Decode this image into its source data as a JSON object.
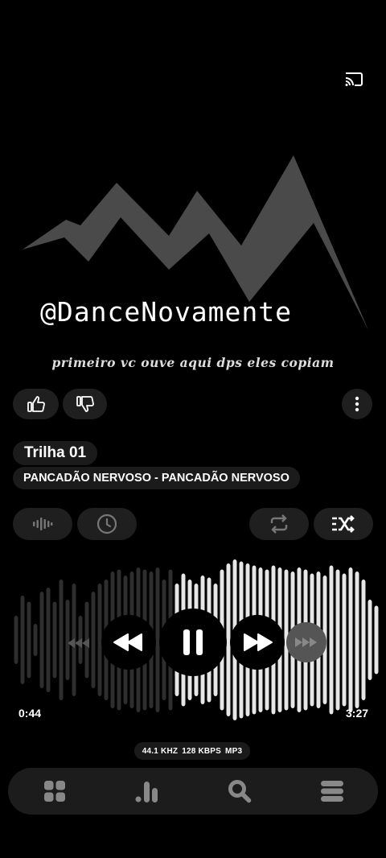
{
  "brand": {
    "logo_text": "@DanceNovamente",
    "tagline": "primeiro vc ouve aqui dps eles copiam"
  },
  "track": {
    "title": "Trilha 01",
    "artist": "PANCADÃO NERVOSO - PANCADÃO NERVOSO"
  },
  "playback": {
    "elapsed": "0:44",
    "duration": "3:27",
    "progress": 0.575
  },
  "quality": {
    "sample_rate": "44.1 KHZ",
    "bitrate": "128 KBPS",
    "format": "MP3"
  },
  "icons": {
    "cast": "cast-icon",
    "like": "thumbs-up-icon",
    "dislike": "thumbs-down-icon",
    "more": "more-vertical-icon",
    "equalizer": "audio-wave-icon",
    "timer": "clock-icon",
    "repeat": "repeat-icon",
    "shuffle": "shuffle-icon",
    "rewind": "rewind-icon",
    "pause": "pause-icon",
    "forward": "fast-forward-icon",
    "nav_home": "grid-icon",
    "nav_stats": "bar-chart-icon",
    "nav_search": "search-icon",
    "nav_library": "menu-icon"
  },
  "colors": {
    "background": "#000000",
    "pill": "#1f1f1f",
    "wave_played": "#e6e6e6",
    "wave_unplayed": "#2e2e2e"
  }
}
